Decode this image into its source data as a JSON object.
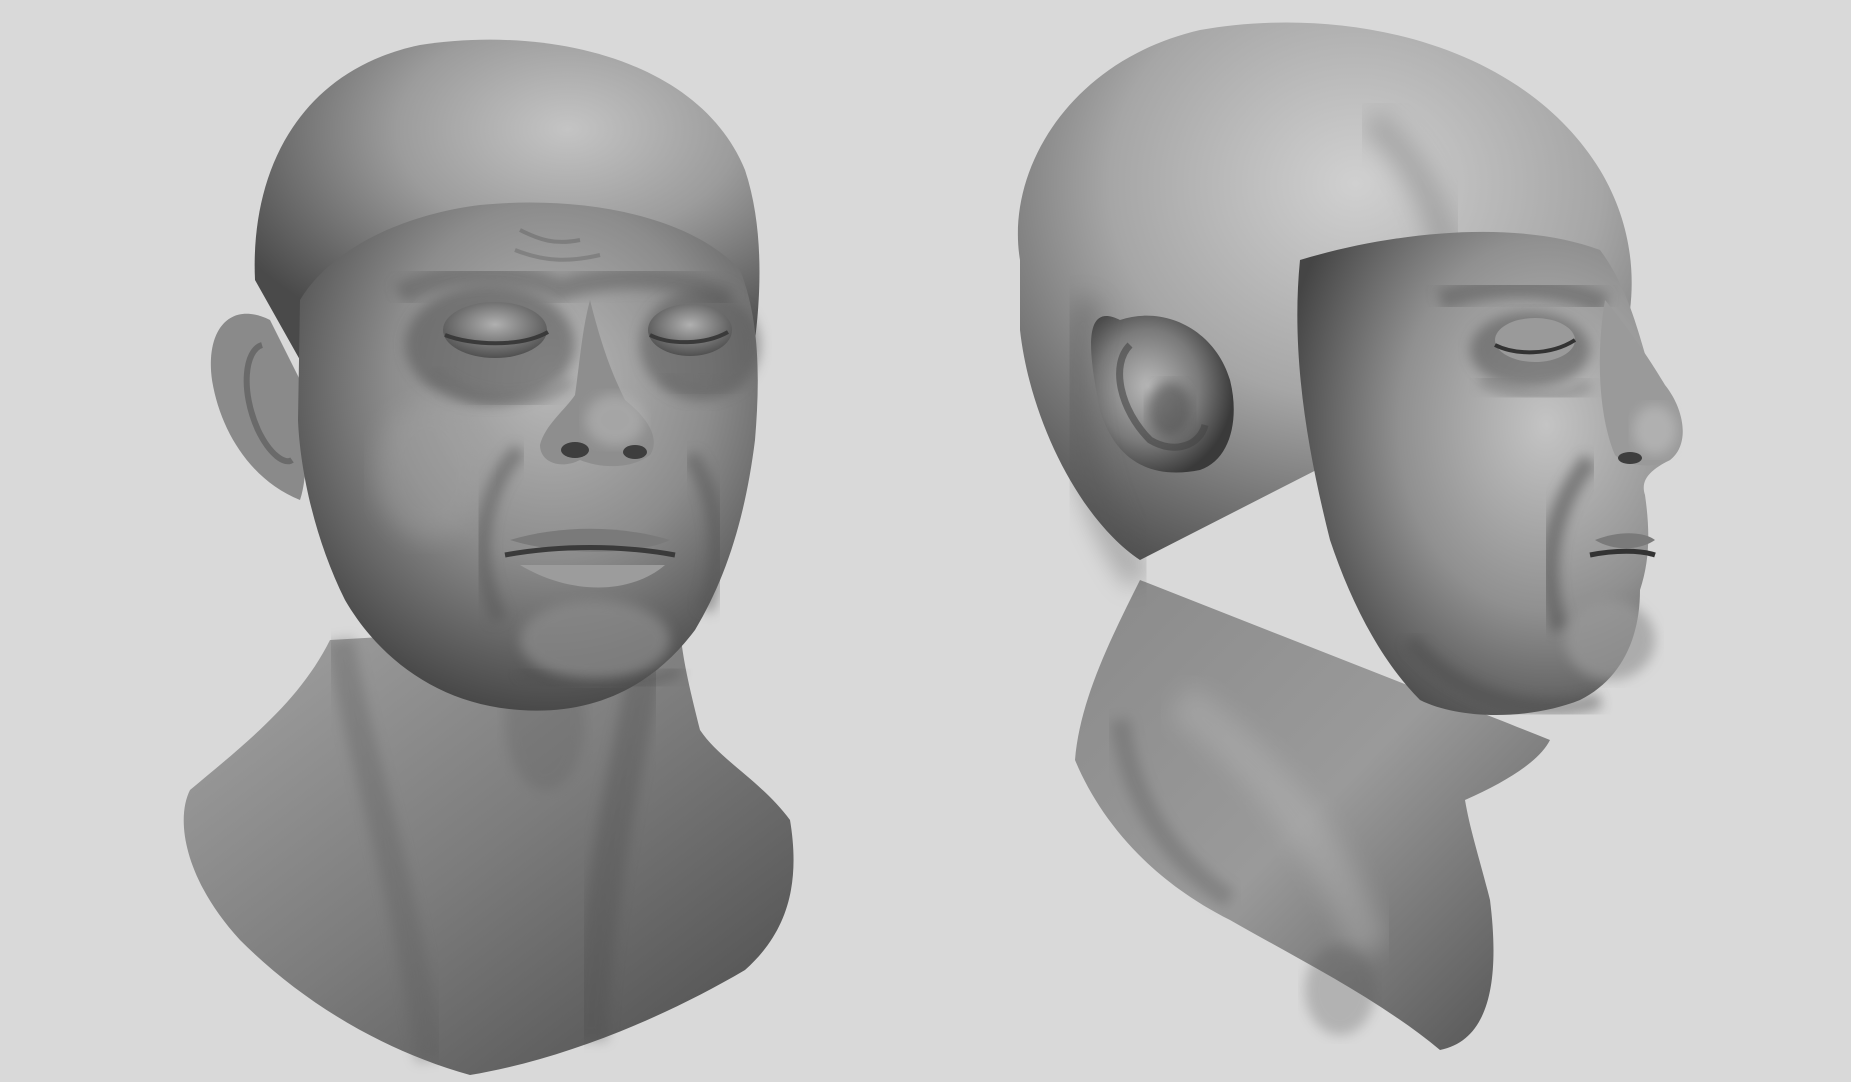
{
  "scene": {
    "background_color": "#d9d9d9",
    "material_color": "#8f8f8f",
    "views": [
      {
        "name": "front-three-quarter-view",
        "description_icon": "sculpted-head-front"
      },
      {
        "name": "side-three-quarter-view",
        "description_icon": "sculpted-head-side"
      }
    ]
  }
}
